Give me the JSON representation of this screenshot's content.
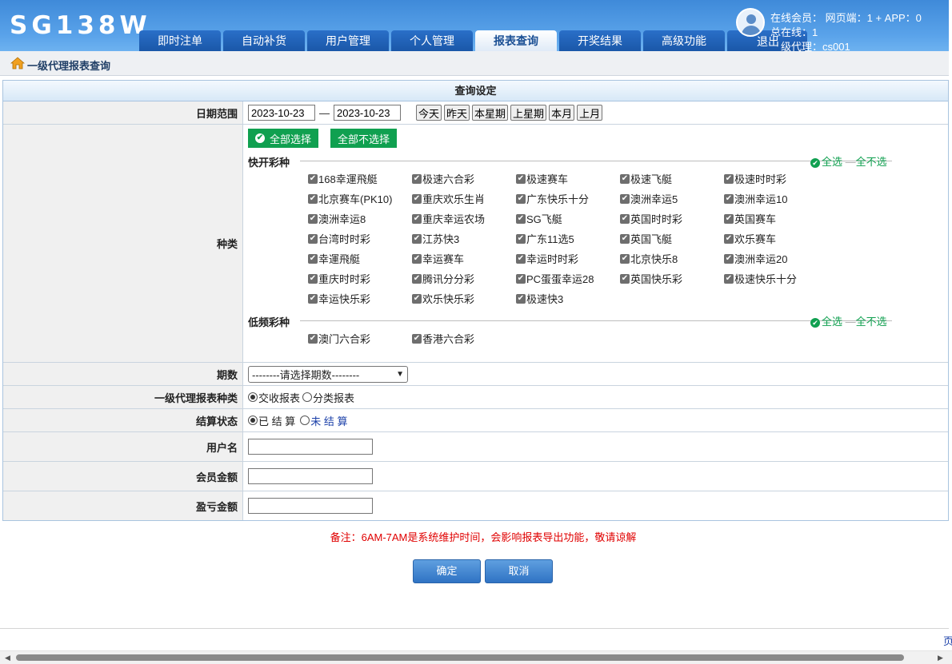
{
  "header": {
    "logo": "SG138W",
    "nav": [
      "即时注单",
      "自动补货",
      "用户管理",
      "个人管理",
      "报表查询",
      "开奖结果",
      "高级功能"
    ],
    "active_nav": "报表查询",
    "online_members": "在线会员：  网页端：1 + APP：0",
    "total_online": "总在线：1",
    "agent_level": "级代理：cs001",
    "logout": "退出"
  },
  "breadcrumb": {
    "text": "一级代理报表查询"
  },
  "form": {
    "title": "查询设定",
    "date_range": {
      "label": "日期范围",
      "from": "2023-10-23",
      "sep": "—",
      "to": "2023-10-23",
      "quick": [
        "今天",
        "昨天",
        "本星期",
        "上星期",
        "本月",
        "上月"
      ]
    },
    "category": {
      "label": "种类",
      "select_all": "全部选择",
      "deselect_all": "全部不选择",
      "groups": [
        {
          "name": "快开彩种",
          "all": "全选",
          "none": "全不选",
          "items": [
            "168幸運飛艇",
            "极速六合彩",
            "极速赛车",
            "极速飞艇",
            "极速时时彩",
            "北京赛车(PK10)",
            "重庆欢乐生肖",
            "广东快乐十分",
            "澳洲幸运5",
            "澳洲幸运10",
            "澳洲幸运8",
            "重庆幸运农场",
            "SG飞艇",
            "英国时时彩",
            "英国赛车",
            "台湾时时彩",
            "江苏快3",
            "广东11选5",
            "英国飞艇",
            "欢乐赛车",
            "幸運飛艇",
            "幸运赛车",
            "幸运时时彩",
            "北京快乐8",
            "澳洲幸运20",
            "重庆时时彩",
            "腾讯分分彩",
            "PC蛋蛋幸运28",
            "英国快乐彩",
            "极速快乐十分",
            "幸运快乐彩",
            "欢乐快乐彩",
            "极速快3"
          ]
        },
        {
          "name": "低频彩种",
          "all": "全选",
          "none": "全不选",
          "items": [
            "澳门六合彩",
            "香港六合彩"
          ]
        }
      ]
    },
    "period": {
      "label": "期数",
      "value": "--------请选择期数--------"
    },
    "report_type": {
      "label": "一级代理报表种类",
      "options": [
        "交收报表",
        "分类报表"
      ],
      "selected": 0
    },
    "settle_status": {
      "label": "结算状态",
      "options": [
        "已 结 算",
        "未 结 算"
      ],
      "selected": 0
    },
    "username": {
      "label": "用户名",
      "value": ""
    },
    "member_amount": {
      "label": "会员金额",
      "value": ""
    },
    "profit_amount": {
      "label": "盈亏金额",
      "value": ""
    }
  },
  "note": "备注：6AM-7AM是系统维护时间，会影响报表导出功能，敬请谅解",
  "buttons": {
    "confirm": "确定",
    "cancel": "取消"
  },
  "edge_char": "页",
  "colors": {
    "header": "#4f97e3",
    "green": "#10a050",
    "note": "#e00000"
  }
}
